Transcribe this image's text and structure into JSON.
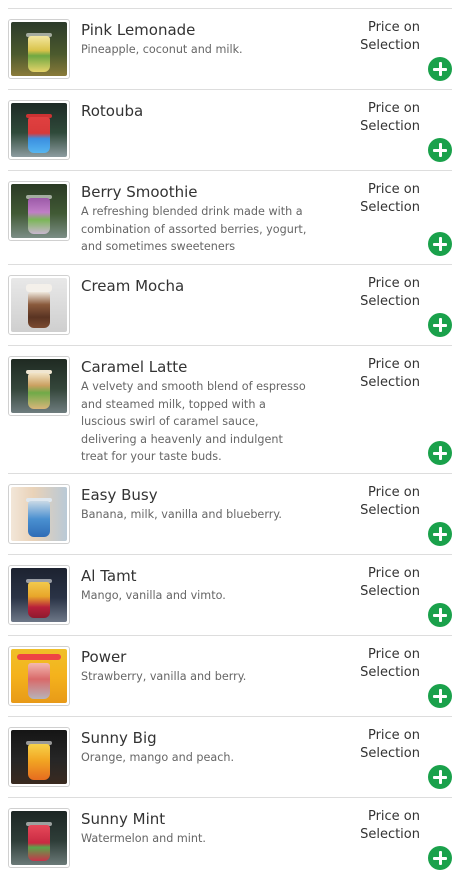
{
  "accent_color": "#1aa14b",
  "add_icon": "plus-circle-icon",
  "items": [
    {
      "name": "Pink Lemonade",
      "description": "Pineapple, coconut and milk.",
      "price_line1": "Price on",
      "price_line2": "Selection"
    },
    {
      "name": "Rotouba",
      "description": "",
      "price_line1": "Price on",
      "price_line2": "Selection"
    },
    {
      "name": "Berry Smoothie",
      "description": "A refreshing blended drink made with a combination of assorted berries, yogurt, and sometimes sweeteners",
      "price_line1": "Price on",
      "price_line2": "Selection"
    },
    {
      "name": "Cream Mocha",
      "description": "",
      "price_line1": "Price on",
      "price_line2": "Selection"
    },
    {
      "name": "Caramel Latte",
      "description": "A velvety and smooth blend of espresso and steamed milk, topped with a luscious swirl of caramel sauce, delivering a heavenly and indulgent treat for your taste buds.",
      "price_line1": "Price on",
      "price_line2": "Selection"
    },
    {
      "name": "Easy Busy",
      "description": "Banana, milk, vanilla and blueberry.",
      "price_line1": "Price on",
      "price_line2": "Selection"
    },
    {
      "name": "Al Tamt",
      "description": "Mango, vanilla and vimto.",
      "price_line1": "Price on",
      "price_line2": "Selection"
    },
    {
      "name": "Power",
      "description": "Strawberry, vanilla and berry.",
      "price_line1": "Price on",
      "price_line2": "Selection"
    },
    {
      "name": "Sunny Big",
      "description": "Orange, mango and peach.",
      "price_line1": "Price on",
      "price_line2": "Selection"
    },
    {
      "name": "Sunny Mint",
      "description": "Watermelon and mint.",
      "price_line1": "Price on",
      "price_line2": "Selection"
    }
  ]
}
